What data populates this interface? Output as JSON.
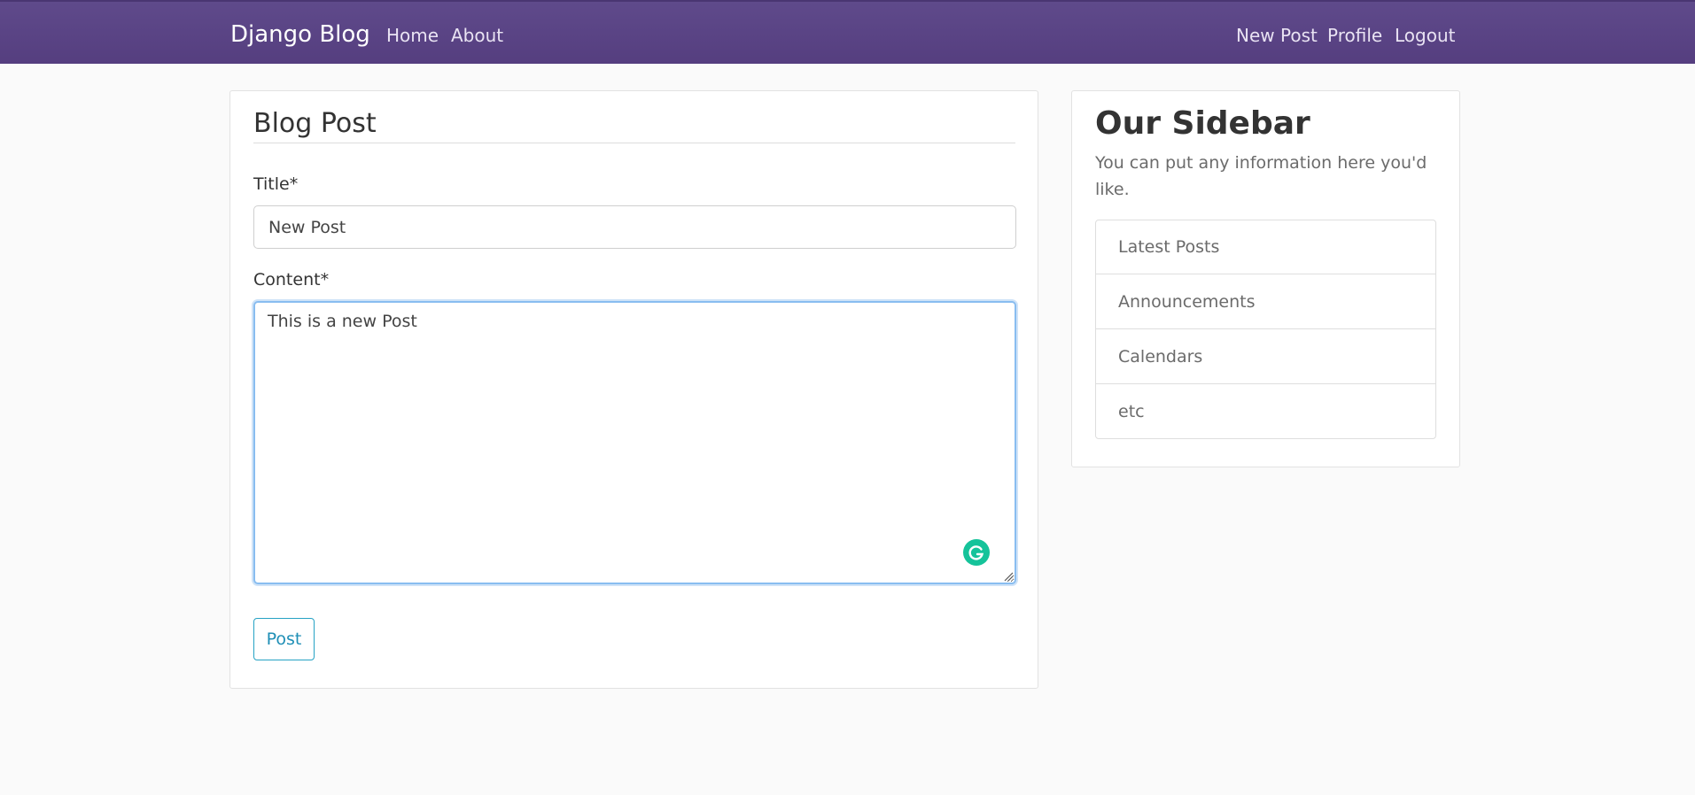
{
  "navbar": {
    "brand": "Django Blog",
    "left_links": [
      "Home",
      "About"
    ],
    "right_links": [
      "New Post",
      "Profile",
      "Logout"
    ]
  },
  "form": {
    "legend": "Blog Post",
    "title_label": "Title*",
    "title_value": "New Post",
    "content_label": "Content*",
    "content_value": "This is a new Post",
    "submit_label": "Post"
  },
  "sidebar": {
    "title": "Our Sidebar",
    "text": "You can put any information here you'd like.",
    "items": [
      "Latest Posts",
      "Announcements",
      "Calendars",
      "etc"
    ]
  },
  "colors": {
    "navbar_bg": "#5f4a8b",
    "accent": "#26a2c4",
    "grammarly": "#15c39a"
  }
}
